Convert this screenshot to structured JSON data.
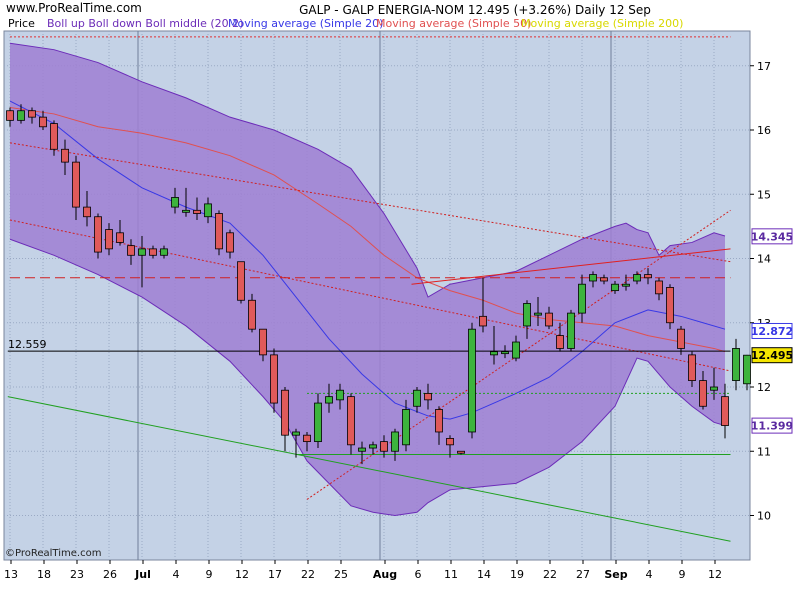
{
  "header": {
    "site_url": "www.ProRealTime.com",
    "title": "GALP - GALP ENERGIA-NOM     12.495 (+3.26%)    Daily  12 Sep",
    "footer_brand": "©ProRealTime.com"
  },
  "colors": {
    "background": "#ffffff",
    "plot_bg": "#c4d2e6",
    "grid": "#9aa9c4",
    "boll_fill": "#9f7fd2",
    "boll_line": "#6c2cb8",
    "sma20": "#3838e6",
    "sma50": "#e05050",
    "sma200": "#d8d800",
    "candle_up": "#3db43d",
    "candle_down": "#e05a5a",
    "candle_edge": "#000000"
  },
  "chart_data": {
    "type": "candlestick",
    "title": "GALP - GALP ENERGIA-NOM 12.495 (+3.26%) Daily 12 Sep",
    "instrument": "GALP - GALP ENERGIA-NOM",
    "last_price": 12.495,
    "change_pct": "+3.26%",
    "period": "Daily",
    "date": "12 Sep",
    "ylim": [
      9.4,
      17.8
    ],
    "y_ticks": [
      "10",
      "11",
      "12",
      "13",
      "14",
      "15",
      "16",
      "17"
    ],
    "grid": true,
    "legend_position": "top-left",
    "legend": [
      {
        "label": "Price",
        "color": "#000000"
      },
      {
        "label": "Boll up Boll down Boll middle (20 2)",
        "color": "#6c2cb8"
      },
      {
        "label": "Moving average (Simple 20)",
        "color": "#3838e6"
      },
      {
        "label": "Moving average (Simple 50)",
        "color": "#e05050"
      },
      {
        "label": "Moving average (Simple 200)",
        "color": "#d8d800"
      }
    ],
    "x_tick_labels": [
      {
        "i": 0,
        "label": "13",
        "bold": false
      },
      {
        "i": 3,
        "label": "18",
        "bold": false
      },
      {
        "i": 6,
        "label": "23",
        "bold": false
      },
      {
        "i": 9,
        "label": "26",
        "bold": false
      },
      {
        "i": 12,
        "label": "Jul",
        "bold": true
      },
      {
        "i": 15,
        "label": "4",
        "bold": false
      },
      {
        "i": 18,
        "label": "9",
        "bold": false
      },
      {
        "i": 21,
        "label": "12",
        "bold": false
      },
      {
        "i": 24,
        "label": "17",
        "bold": false
      },
      {
        "i": 27,
        "label": "22",
        "bold": false
      },
      {
        "i": 30,
        "label": "25",
        "bold": false
      },
      {
        "i": 34,
        "label": "Aug",
        "bold": true
      },
      {
        "i": 37,
        "label": "6",
        "bold": false
      },
      {
        "i": 40,
        "label": "11",
        "bold": false
      },
      {
        "i": 43,
        "label": "14",
        "bold": false
      },
      {
        "i": 46,
        "label": "19",
        "bold": false
      },
      {
        "i": 49,
        "label": "22",
        "bold": false
      },
      {
        "i": 52,
        "label": "27",
        "bold": false
      },
      {
        "i": 55,
        "label": "Sep",
        "bold": true
      },
      {
        "i": 58,
        "label": "4",
        "bold": false
      },
      {
        "i": 61,
        "label": "9",
        "bold": false
      },
      {
        "i": 64,
        "label": "12",
        "bold": false
      }
    ],
    "month_separators": [
      12,
      34,
      55
    ],
    "candles": [
      {
        "o": 16.3,
        "h": 16.35,
        "l": 16.05,
        "c": 16.15
      },
      {
        "o": 16.15,
        "h": 16.4,
        "l": 16.1,
        "c": 16.3
      },
      {
        "o": 16.3,
        "h": 16.35,
        "l": 16.1,
        "c": 16.2
      },
      {
        "o": 16.2,
        "h": 16.3,
        "l": 16.0,
        "c": 16.05
      },
      {
        "o": 16.1,
        "h": 16.15,
        "l": 15.6,
        "c": 15.7
      },
      {
        "o": 15.7,
        "h": 15.85,
        "l": 15.3,
        "c": 15.5
      },
      {
        "o": 15.5,
        "h": 15.6,
        "l": 14.6,
        "c": 14.8
      },
      {
        "o": 14.8,
        "h": 15.05,
        "l": 14.5,
        "c": 14.65
      },
      {
        "o": 14.65,
        "h": 14.7,
        "l": 14.0,
        "c": 14.1
      },
      {
        "o": 14.45,
        "h": 14.55,
        "l": 14.05,
        "c": 14.15
      },
      {
        "o": 14.4,
        "h": 14.6,
        "l": 14.2,
        "c": 14.25
      },
      {
        "o": 14.2,
        "h": 14.3,
        "l": 13.9,
        "c": 14.05
      },
      {
        "o": 14.05,
        "h": 14.35,
        "l": 13.55,
        "c": 14.15
      },
      {
        "o": 14.15,
        "h": 14.2,
        "l": 14.0,
        "c": 14.05
      },
      {
        "o": 14.05,
        "h": 14.2,
        "l": 14.0,
        "c": 14.15
      },
      {
        "o": 14.8,
        "h": 15.1,
        "l": 14.7,
        "c": 14.95
      },
      {
        "o": 14.75,
        "h": 15.1,
        "l": 14.65,
        "c": 14.75
      },
      {
        "o": 14.75,
        "h": 14.95,
        "l": 14.6,
        "c": 14.7
      },
      {
        "o": 14.65,
        "h": 14.95,
        "l": 14.55,
        "c": 14.85
      },
      {
        "o": 14.7,
        "h": 14.75,
        "l": 14.05,
        "c": 14.15
      },
      {
        "o": 14.4,
        "h": 14.45,
        "l": 14.0,
        "c": 14.1
      },
      {
        "o": 13.95,
        "h": 13.95,
        "l": 13.3,
        "c": 13.35
      },
      {
        "o": 13.35,
        "h": 13.45,
        "l": 12.85,
        "c": 12.9
      },
      {
        "o": 12.9,
        "h": 12.9,
        "l": 12.4,
        "c": 12.5
      },
      {
        "o": 12.5,
        "h": 12.6,
        "l": 11.6,
        "c": 11.75
      },
      {
        "o": 11.95,
        "h": 12.0,
        "l": 11.0,
        "c": 11.25
      },
      {
        "o": 11.25,
        "h": 11.35,
        "l": 10.9,
        "c": 11.3
      },
      {
        "o": 11.25,
        "h": 11.3,
        "l": 11.0,
        "c": 11.15
      },
      {
        "o": 11.15,
        "h": 11.9,
        "l": 11.05,
        "c": 11.75
      },
      {
        "o": 11.75,
        "h": 12.05,
        "l": 11.6,
        "c": 11.85
      },
      {
        "o": 11.8,
        "h": 12.05,
        "l": 11.65,
        "c": 11.95
      },
      {
        "o": 11.85,
        "h": 11.9,
        "l": 10.95,
        "c": 11.1
      },
      {
        "o": 11.0,
        "h": 11.15,
        "l": 10.8,
        "c": 11.05
      },
      {
        "o": 11.05,
        "h": 11.15,
        "l": 10.95,
        "c": 11.1
      },
      {
        "o": 11.15,
        "h": 11.25,
        "l": 10.9,
        "c": 11.0
      },
      {
        "o": 11.0,
        "h": 11.35,
        "l": 10.85,
        "c": 11.3
      },
      {
        "o": 11.1,
        "h": 11.8,
        "l": 11.0,
        "c": 11.65
      },
      {
        "o": 11.7,
        "h": 12.0,
        "l": 11.6,
        "c": 11.95
      },
      {
        "o": 11.9,
        "h": 12.05,
        "l": 11.65,
        "c": 11.8
      },
      {
        "o": 11.65,
        "h": 11.7,
        "l": 11.1,
        "c": 11.3
      },
      {
        "o": 11.2,
        "h": 11.25,
        "l": 10.9,
        "c": 11.1
      },
      {
        "o": 11.0,
        "h": 11.0,
        "l": 10.95,
        "c": 10.98
      },
      {
        "o": 11.3,
        "h": 13.0,
        "l": 11.2,
        "c": 12.9
      },
      {
        "o": 13.1,
        "h": 13.7,
        "l": 12.85,
        "c": 12.95
      },
      {
        "o": 12.5,
        "h": 12.95,
        "l": 12.35,
        "c": 12.55
      },
      {
        "o": 12.55,
        "h": 12.65,
        "l": 12.45,
        "c": 12.55
      },
      {
        "o": 12.45,
        "h": 12.8,
        "l": 12.4,
        "c": 12.7
      },
      {
        "o": 12.95,
        "h": 13.35,
        "l": 12.75,
        "c": 13.3
      },
      {
        "o": 13.15,
        "h": 13.4,
        "l": 12.95,
        "c": 13.15
      },
      {
        "o": 13.15,
        "h": 13.25,
        "l": 12.9,
        "c": 12.95
      },
      {
        "o": 12.8,
        "h": 13.0,
        "l": 12.55,
        "c": 12.6
      },
      {
        "o": 12.6,
        "h": 13.2,
        "l": 12.55,
        "c": 13.15
      },
      {
        "o": 13.15,
        "h": 13.75,
        "l": 13.0,
        "c": 13.6
      },
      {
        "o": 13.65,
        "h": 13.8,
        "l": 13.55,
        "c": 13.75
      },
      {
        "o": 13.7,
        "h": 13.75,
        "l": 13.6,
        "c": 13.65
      },
      {
        "o": 13.5,
        "h": 13.65,
        "l": 13.45,
        "c": 13.6
      },
      {
        "o": 13.6,
        "h": 13.75,
        "l": 13.5,
        "c": 13.6
      },
      {
        "o": 13.65,
        "h": 13.8,
        "l": 13.6,
        "c": 13.75
      },
      {
        "o": 13.75,
        "h": 13.85,
        "l": 13.6,
        "c": 13.7
      },
      {
        "o": 13.65,
        "h": 13.7,
        "l": 13.35,
        "c": 13.45
      },
      {
        "o": 13.55,
        "h": 13.6,
        "l": 12.9,
        "c": 13.0
      },
      {
        "o": 12.9,
        "h": 12.95,
        "l": 12.5,
        "c": 12.6
      },
      {
        "o": 12.5,
        "h": 12.55,
        "l": 12.0,
        "c": 12.1
      },
      {
        "o": 12.1,
        "h": 12.25,
        "l": 11.65,
        "c": 11.7
      },
      {
        "o": 11.95,
        "h": 12.3,
        "l": 11.8,
        "c": 12.0
      },
      {
        "o": 11.85,
        "h": 12.05,
        "l": 11.2,
        "c": 11.4
      },
      {
        "o": 12.1,
        "h": 12.75,
        "l": 11.95,
        "c": 12.6
      },
      {
        "o": 12.05,
        "h": 12.5,
        "l": 11.95,
        "c": 12.495
      }
    ],
    "bollinger_upper": [
      [
        0,
        17.35
      ],
      [
        4,
        17.25
      ],
      [
        8,
        17.05
      ],
      [
        12,
        16.75
      ],
      [
        16,
        16.5
      ],
      [
        20,
        16.2
      ],
      [
        24,
        16.0
      ],
      [
        28,
        15.7
      ],
      [
        31,
        15.4
      ],
      [
        34,
        14.7
      ],
      [
        37,
        13.85
      ],
      [
        38,
        13.4
      ],
      [
        40,
        13.6
      ],
      [
        43,
        13.7
      ],
      [
        46,
        13.8
      ],
      [
        49,
        14.05
      ],
      [
        52,
        14.3
      ],
      [
        55,
        14.5
      ],
      [
        56,
        14.55
      ],
      [
        57,
        14.45
      ],
      [
        58,
        14.4
      ],
      [
        59,
        14.05
      ],
      [
        60,
        14.2
      ],
      [
        62,
        14.25
      ],
      [
        64,
        14.4
      ],
      [
        65,
        14.35
      ]
    ],
    "bollinger_lower": [
      [
        0,
        14.3
      ],
      [
        4,
        14.05
      ],
      [
        8,
        13.75
      ],
      [
        12,
        13.4
      ],
      [
        16,
        12.95
      ],
      [
        20,
        12.4
      ],
      [
        23,
        11.85
      ],
      [
        25,
        11.45
      ],
      [
        27,
        10.85
      ],
      [
        29,
        10.5
      ],
      [
        31,
        10.15
      ],
      [
        33,
        10.05
      ],
      [
        35,
        10.0
      ],
      [
        37,
        10.05
      ],
      [
        38,
        10.2
      ],
      [
        40,
        10.4
      ],
      [
        43,
        10.45
      ],
      [
        46,
        10.5
      ],
      [
        49,
        10.75
      ],
      [
        52,
        11.15
      ],
      [
        55,
        11.7
      ],
      [
        57,
        12.45
      ],
      [
        58,
        12.4
      ],
      [
        60,
        12.0
      ],
      [
        62,
        11.7
      ],
      [
        64,
        11.45
      ],
      [
        65,
        11.4
      ]
    ],
    "sma20": [
      [
        0,
        16.45
      ],
      [
        4,
        16.1
      ],
      [
        8,
        15.55
      ],
      [
        12,
        15.1
      ],
      [
        16,
        14.8
      ],
      [
        20,
        14.55
      ],
      [
        23,
        14.05
      ],
      [
        26,
        13.4
      ],
      [
        29,
        12.75
      ],
      [
        32,
        12.2
      ],
      [
        35,
        11.75
      ],
      [
        38,
        11.55
      ],
      [
        40,
        11.5
      ],
      [
        42,
        11.6
      ],
      [
        44,
        11.75
      ],
      [
        46,
        11.9
      ],
      [
        49,
        12.15
      ],
      [
        52,
        12.55
      ],
      [
        55,
        13.0
      ],
      [
        58,
        13.2
      ],
      [
        61,
        13.1
      ],
      [
        63,
        13.0
      ],
      [
        65,
        12.9
      ]
    ],
    "sma50": [
      [
        0,
        16.35
      ],
      [
        4,
        16.25
      ],
      [
        8,
        16.05
      ],
      [
        12,
        15.95
      ],
      [
        16,
        15.8
      ],
      [
        20,
        15.6
      ],
      [
        24,
        15.3
      ],
      [
        28,
        14.85
      ],
      [
        31,
        14.5
      ],
      [
        34,
        14.05
      ],
      [
        37,
        13.7
      ],
      [
        40,
        13.5
      ],
      [
        43,
        13.35
      ],
      [
        46,
        13.15
      ],
      [
        49,
        13.05
      ],
      [
        52,
        13.0
      ],
      [
        55,
        12.95
      ],
      [
        58,
        12.8
      ],
      [
        61,
        12.7
      ],
      [
        64,
        12.6
      ],
      [
        65,
        12.55
      ]
    ],
    "trendlines": [
      {
        "name": "resistance-upper-dotted",
        "color": "#e03030",
        "dash": "2,2",
        "from": [
          0,
          17.45
        ],
        "to": [
          65.5,
          17.45
        ]
      },
      {
        "name": "downtrend-dotted-1",
        "color": "#d02020",
        "dash": "2,2",
        "from": [
          0,
          15.8
        ],
        "to": [
          65.5,
          13.95
        ]
      },
      {
        "name": "downtrend-dotted-2",
        "color": "#d02020",
        "dash": "2,2",
        "from": [
          0,
          14.6
        ],
        "to": [
          65.5,
          12.25
        ]
      },
      {
        "name": "support-level-dashed",
        "color": "#d02020",
        "dash": "10,5",
        "from": [
          0,
          13.7
        ],
        "to": [
          65.5,
          13.7
        ]
      },
      {
        "name": "rising-resistance-solid",
        "color": "#e02020",
        "dash": "",
        "from": [
          36.5,
          13.6
        ],
        "to": [
          65.5,
          14.15
        ]
      },
      {
        "name": "rising-support-dotted",
        "color": "#d02020",
        "dash": "2,2",
        "from": [
          27,
          10.25
        ],
        "to": [
          65.5,
          14.75
        ]
      },
      {
        "name": "long-support-green",
        "color": "#20a020",
        "dash": "",
        "from": [
          -0.2,
          11.85
        ],
        "to": [
          65.5,
          9.6
        ]
      },
      {
        "name": "horizontal-green",
        "color": "#20a020",
        "dash": "",
        "from": [
          26,
          10.95
        ],
        "to": [
          65.5,
          10.95
        ]
      },
      {
        "name": "horizontal-green-dotted",
        "color": "#20a020",
        "dash": "2,2",
        "from": [
          27,
          11.9
        ],
        "to": [
          65.5,
          11.9
        ]
      },
      {
        "name": "reference-line-black",
        "color": "#000000",
        "dash": "",
        "from": [
          -0.2,
          12.559
        ],
        "to": [
          65.5,
          12.559
        ]
      }
    ],
    "annotations": [
      {
        "label": "12.559",
        "value": 12.559,
        "side": "left",
        "color": "#000000"
      }
    ],
    "price_tags": [
      {
        "label": "14.345",
        "value": 14.345,
        "fill": "#ffffff",
        "stroke": "#6c2cb8",
        "text": "#5a2aa0"
      },
      {
        "label": "12.872",
        "value": 12.872,
        "fill": "#ffffff",
        "stroke": "#3838e6",
        "text": "#3838e6"
      },
      {
        "label": "12.495",
        "value": 12.495,
        "fill": "#f5e600",
        "stroke": "#000000",
        "text": "#000000"
      },
      {
        "label": "11.399",
        "value": 11.399,
        "fill": "#ffffff",
        "stroke": "#6c2cb8",
        "text": "#5a2aa0"
      }
    ]
  }
}
